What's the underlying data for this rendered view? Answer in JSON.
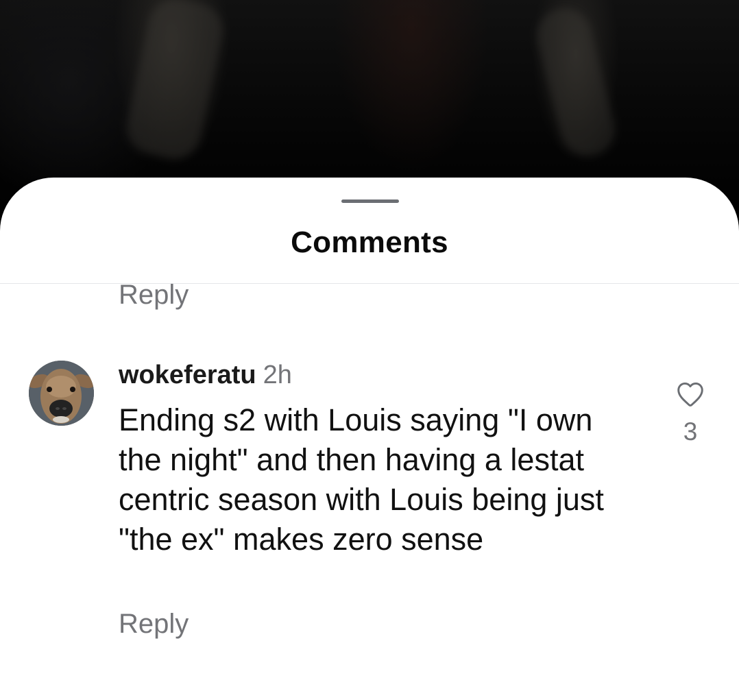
{
  "sheet": {
    "title": "Comments"
  },
  "partial_comment": {
    "reply_label": "Reply"
  },
  "comment": {
    "username": "wokeferatu",
    "time": "2h",
    "text": "Ending s2 with Louis saying \"I own the night\" and then having a lestat centric season with Louis being just \"the ex\" makes zero sense",
    "reply_label": "Reply",
    "like_count": "3",
    "icons": {
      "avatar": "deer-avatar",
      "like": "heart-outline-icon"
    }
  },
  "colors": {
    "sheet_background": "#ffffff",
    "secondary_text": "#737478",
    "primary_text": "#111111"
  }
}
